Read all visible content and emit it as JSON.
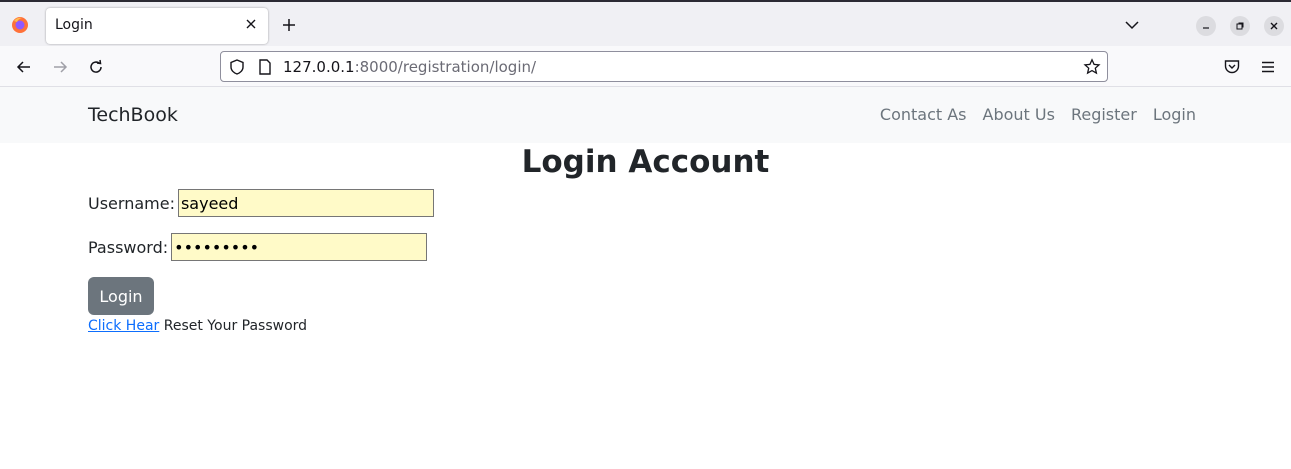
{
  "browser": {
    "tab_title": "Login",
    "url_host": "127.0.0.1",
    "url_rest": ":8000/registration/login/"
  },
  "site": {
    "brand": "TechBook",
    "nav_links": [
      "Contact As",
      "About Us",
      "Register",
      "Login"
    ]
  },
  "page": {
    "heading": "Login Account",
    "username_label": "Username:",
    "username_value": "sayeed",
    "password_label": "Password:",
    "password_value": "sayeed123",
    "login_button": "Login",
    "reset_link_text": "Click Hear",
    "reset_text": "Reset Your Password"
  },
  "colors": {
    "accent_button": "#6c757d",
    "link": "#0d6efd",
    "autofill_bg": "#fffac8"
  },
  "icons": [
    "firefox-icon",
    "close-icon",
    "plus-icon",
    "chevron-down-icon",
    "minimize-icon",
    "restore-icon",
    "back-icon",
    "forward-icon",
    "reload-icon",
    "shield-icon",
    "page-icon",
    "star-icon",
    "pocket-icon",
    "menu-icon"
  ]
}
